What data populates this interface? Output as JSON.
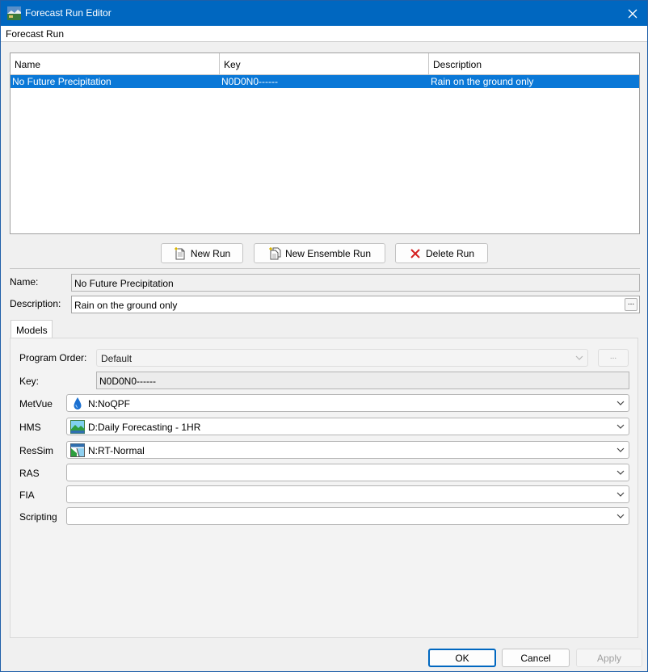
{
  "window": {
    "title": "Forecast Run Editor"
  },
  "menu": {
    "items": [
      "Forecast Run"
    ]
  },
  "table": {
    "headers": [
      "Name",
      "Key",
      "Description"
    ],
    "rows": [
      {
        "name": "No Future Precipitation",
        "key": "N0D0N0------",
        "description": "Rain on the ground only",
        "selected": true
      }
    ]
  },
  "toolbar": {
    "new_run": "New Run",
    "new_ensemble_run": "New Ensemble Run",
    "delete_run": "Delete Run"
  },
  "details": {
    "name_label": "Name:",
    "name_value": "No Future Precipitation",
    "description_label": "Description:",
    "description_value": "Rain on the ground only",
    "ellipsis": "..."
  },
  "tabs": [
    {
      "label": "Models",
      "active": true
    }
  ],
  "models": {
    "program_order_label": "Program Order:",
    "program_order_value": "Default",
    "program_order_button": "...",
    "key_label": "Key:",
    "key_value": "N0D0N0------",
    "rows": [
      {
        "label": "MetVue",
        "value": "N:NoQPF",
        "icon": "water-drop-icon"
      },
      {
        "label": "HMS",
        "value": "D:Daily Forecasting - 1HR",
        "icon": "landscape-icon"
      },
      {
        "label": "ResSim",
        "value": "N:RT-Normal",
        "icon": "reservoir-icon"
      },
      {
        "label": "RAS",
        "value": ""
      },
      {
        "label": "FIA",
        "value": ""
      },
      {
        "label": "Scripting",
        "value": ""
      }
    ]
  },
  "footer": {
    "ok": "OK",
    "cancel": "Cancel",
    "apply": "Apply"
  },
  "colors": {
    "titlebar": "#0067c0",
    "selection": "#0a78d7",
    "delete_icon": "#d42020",
    "ok_border": "#0067c0"
  }
}
